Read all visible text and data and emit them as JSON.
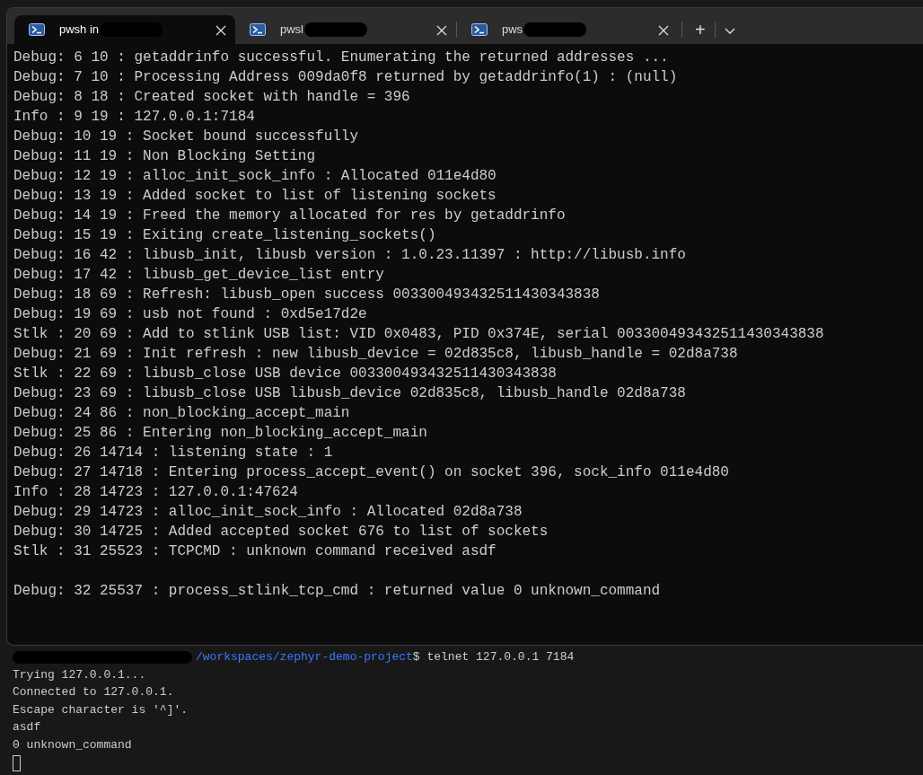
{
  "terminal_window": {
    "tabs": [
      {
        "label": "pwsh in",
        "selected": true
      },
      {
        "label": "pwsl",
        "selected": false
      },
      {
        "label": "pws",
        "selected": false
      }
    ],
    "new_tab": "+",
    "log_lines": [
      {
        "text": "Debug: 6 10 : getaddrinfo successful. Enumerating the returned addresses ...",
        "gap_before": false
      },
      {
        "text": "Debug: 7 10 : Processing Address 009da0f8 returned by getaddrinfo(1) : (null)",
        "gap_before": false
      },
      {
        "text": "Debug: 8 18 : Created socket with handle = 396",
        "gap_before": false
      },
      {
        "text": "Info : 9 19 : 127.0.0.1:7184",
        "gap_before": false
      },
      {
        "text": "Debug: 10 19 : Socket bound successfully",
        "gap_before": false
      },
      {
        "text": "Debug: 11 19 : Non Blocking Setting",
        "gap_before": false
      },
      {
        "text": "Debug: 12 19 : alloc_init_sock_info : Allocated 011e4d80",
        "gap_before": false
      },
      {
        "text": "Debug: 13 19 : Added socket to list of listening sockets",
        "gap_before": false
      },
      {
        "text": "Debug: 14 19 : Freed the memory allocated for res by getaddrinfo",
        "gap_before": false
      },
      {
        "text": "Debug: 15 19 : Exiting create_listening_sockets()",
        "gap_before": false
      },
      {
        "text": "Debug: 16 42 : libusb_init, libusb version : 1.0.23.11397 : http://libusb.info",
        "gap_before": false
      },
      {
        "text": "Debug: 17 42 : libusb_get_device_list entry",
        "gap_before": false
      },
      {
        "text": "Debug: 18 69 : Refresh: libusb_open success 003300493432511430343838",
        "gap_before": false
      },
      {
        "text": "Debug: 19 69 : usb not found : 0xd5e17d2e",
        "gap_before": false
      },
      {
        "text": "Stlk : 20 69 : Add to stlink USB list: VID 0x0483, PID 0x374E, serial 003300493432511430343838",
        "gap_before": false
      },
      {
        "text": "Debug: 21 69 : Init refresh : new libusb_device = 02d835c8, libusb_handle = 02d8a738",
        "gap_before": false
      },
      {
        "text": "Stlk : 22 69 : libusb_close USB device 003300493432511430343838",
        "gap_before": false
      },
      {
        "text": "Debug: 23 69 : libusb_close USB libusb_device 02d835c8, libusb_handle 02d8a738",
        "gap_before": false
      },
      {
        "text": "Debug: 24 86 : non_blocking_accept_main",
        "gap_before": false
      },
      {
        "text": "Debug: 25 86 : Entering non_blocking_accept_main",
        "gap_before": false
      },
      {
        "text": "Debug: 26 14714 : listening state : 1",
        "gap_before": false
      },
      {
        "text": "Debug: 27 14718 : Entering process_accept_event() on socket 396, sock_info 011e4d80",
        "gap_before": false
      },
      {
        "text": "Info : 28 14723 : 127.0.0.1:47624",
        "gap_before": false
      },
      {
        "text": "Debug: 29 14723 : alloc_init_sock_info : Allocated 02d8a738",
        "gap_before": false
      },
      {
        "text": "Debug: 30 14725 : Added accepted socket 676 to list of sockets",
        "gap_before": false
      },
      {
        "text": "Stlk : 31 25523 : TCPCMD : unknown command received asdf",
        "gap_before": false
      },
      {
        "text": "Debug: 32 25537 : process_stlink_tcp_cmd : returned value 0 unknown_command",
        "gap_before": true
      }
    ]
  },
  "background_terminal": {
    "prompt_path": "/workspaces/zephyr-demo-project",
    "prompt_command": "$ telnet 127.0.0.1 7184",
    "output_lines": [
      "Trying 127.0.0.1...",
      "Connected to 127.0.0.1.",
      "Escape character is '^]'.",
      "asdf",
      "0 unknown_command"
    ]
  }
}
